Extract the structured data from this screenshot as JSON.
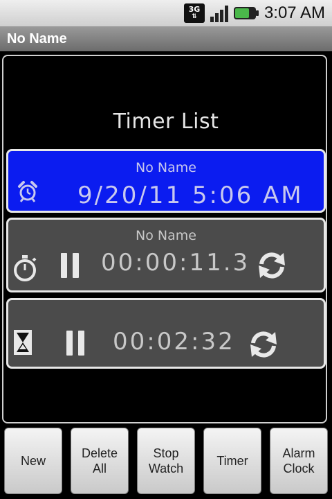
{
  "status_bar": {
    "network": "3G",
    "time": "3:07 AM"
  },
  "title_bar": {
    "title": "No Name"
  },
  "main": {
    "list_title": "Timer List",
    "alarm": {
      "name": "No Name",
      "value": "9/20/11  5:06  AM",
      "icon": "alarm-clock-icon"
    },
    "stopwatch": {
      "name": "No Name",
      "value": "00:00:11.3",
      "icon": "stopwatch-icon"
    },
    "timer": {
      "value": "00:02:32",
      "icon": "hourglass-icon"
    }
  },
  "bottom_buttons": {
    "new": "New",
    "delete_all": "Delete All",
    "stop_watch": "Stop Watch",
    "timer": "Timer",
    "alarm_clock": "Alarm Clock"
  },
  "colors": {
    "alarm_card": "#0b1cf0",
    "timer_card": "#4b4b4b",
    "status_bar": "#e0e0e0",
    "title_bar": "#7f7f7f"
  }
}
